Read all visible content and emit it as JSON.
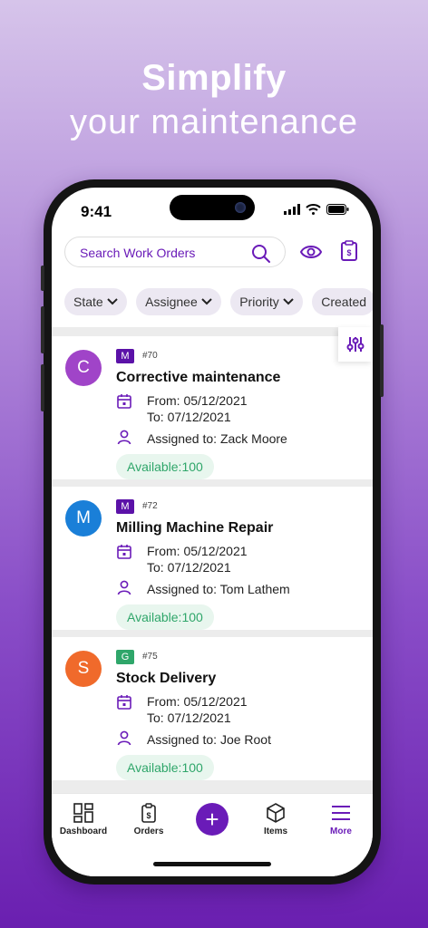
{
  "headline": {
    "line1": "Simplify",
    "line2": "your maintenance"
  },
  "status_bar": {
    "time": "9:41"
  },
  "search": {
    "placeholder": "Search Work Orders"
  },
  "filters": [
    "State",
    "Assignee",
    "Priority",
    "Created"
  ],
  "work_orders": [
    {
      "initial": "C",
      "avatar_color": "#a044c8",
      "badge": "M",
      "badge_color": "#5b12a8",
      "number": "#70",
      "title": "Corrective maintenance",
      "from": "From: 05/12/2021",
      "to": "To: 07/12/2021",
      "assigned": "Assigned to: Zack Moore",
      "available": "Available:100"
    },
    {
      "initial": "M",
      "avatar_color": "#1a7fd8",
      "badge": "M",
      "badge_color": "#5b12a8",
      "number": "#72",
      "title": "Milling Machine Repair",
      "from": "From: 05/12/2021",
      "to": "To: 07/12/2021",
      "assigned": "Assigned to: Tom Lathem",
      "available": "Available:100"
    },
    {
      "initial": "S",
      "avatar_color": "#f06a2b",
      "badge": "G",
      "badge_color": "#2fa66a",
      "number": "#75",
      "title": "Stock Delivery",
      "from": "From: 05/12/2021",
      "to": "To: 07/12/2021",
      "assigned": "Assigned to: Joe Root",
      "available": "Available:100"
    }
  ],
  "tabbar": {
    "dashboard": "Dashboard",
    "orders": "Orders",
    "items": "Items",
    "more": "More",
    "add": "+"
  },
  "colors": {
    "accent": "#6a1bb8",
    "available_bg": "#e8f6ee",
    "available_text": "#2fa66a"
  },
  "icons": [
    "search-icon",
    "eye-icon",
    "clipboard-dollar-icon",
    "chevron-down-icon",
    "sliders-icon",
    "calendar-icon",
    "user-icon",
    "dashboard-icon",
    "orders-icon",
    "cube-icon",
    "menu-icon"
  ]
}
